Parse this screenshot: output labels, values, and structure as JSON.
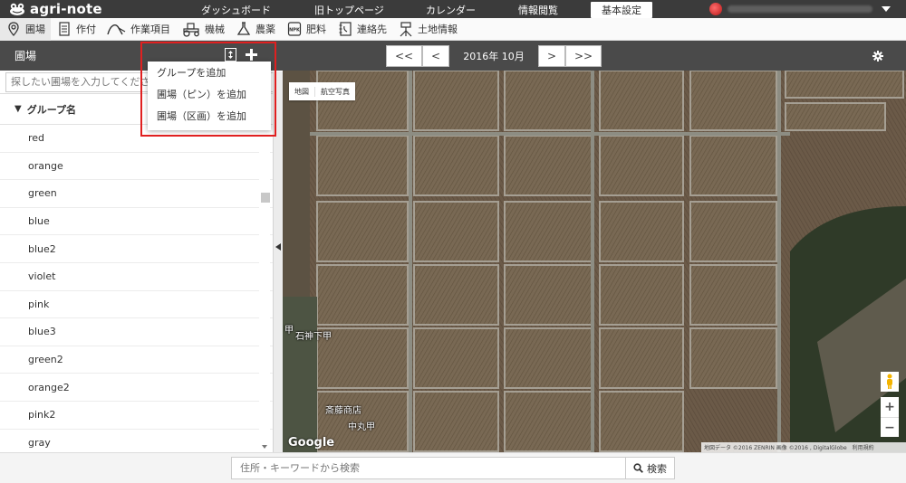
{
  "header": {
    "logo_text": "agri-note",
    "nav": [
      {
        "label": "ダッシュボード"
      },
      {
        "label": "旧トップページ"
      },
      {
        "label": "カレンダー"
      },
      {
        "label": "情報閲覧"
      },
      {
        "label": "基本設定"
      }
    ],
    "user_name_hidden": true
  },
  "menubar": {
    "items": [
      {
        "label": "圃場",
        "icon": "map-pin-icon"
      },
      {
        "label": "作付",
        "icon": "document-icon"
      },
      {
        "label": "作業項目",
        "icon": "work-curve-icon"
      },
      {
        "label": "機械",
        "icon": "tractor-icon"
      },
      {
        "label": "農薬",
        "icon": "flask-icon"
      },
      {
        "label": "肥料",
        "icon": "npk-bag-icon"
      },
      {
        "label": "連絡先",
        "icon": "phonebook-icon"
      },
      {
        "label": "土地情報",
        "icon": "survey-icon"
      }
    ]
  },
  "left_panel": {
    "title": "圃場",
    "search_placeholder": "探したい圃場を入力してください",
    "group_header": "グループ名",
    "items": [
      "red",
      "orange",
      "green",
      "blue",
      "blue2",
      "violet",
      "pink",
      "blue3",
      "green2",
      "orange2",
      "pink2",
      "gray"
    ]
  },
  "dropdown": {
    "items": [
      "グループを追加",
      "圃場（ピン）を追加",
      "圃場（区画）を追加"
    ]
  },
  "map_header": {
    "prev_prev": "<<",
    "prev": "<",
    "month": "2016年 10月",
    "next": ">",
    "next_next": ">>"
  },
  "map": {
    "type_map": "地図",
    "type_satellite": "航空写真",
    "places": [
      "甲",
      "石神下甲",
      "斎藤商店",
      "中丸甲"
    ],
    "google_logo": "Google",
    "attribution": "地図データ ©2016 ZENRIN 画像 ©2016 , DigitalGlobe",
    "terms": "利用規約"
  },
  "bottom": {
    "search_placeholder": "住所・キーワードから検索",
    "search_button": "検索"
  },
  "colors": {
    "header_bg": "#3b3b3b",
    "panel_head_bg": "#4a4a4a",
    "highlight_border": "#e02020"
  }
}
